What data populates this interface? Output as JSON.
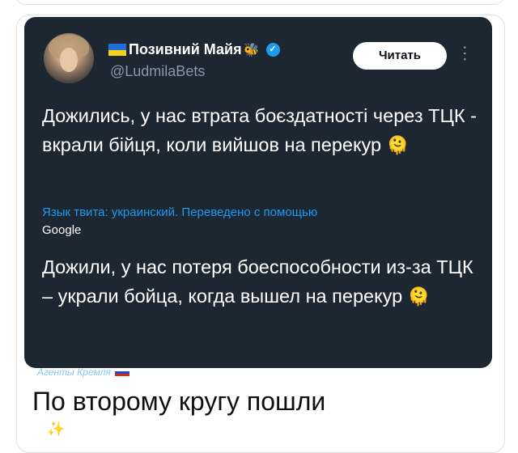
{
  "author": {
    "display_name": "Позивний Майя",
    "handle": "@LudmilaBets",
    "bee_emoji": "🐝",
    "verified_icon": "verified-badge-icon"
  },
  "actions": {
    "read_label": "Читать",
    "more_icon": "more-vertical-icon"
  },
  "tweet": {
    "original_text": "Дожились, у нас втрата боєздатності через ТЦК - вкрали бійця, коли вийшов на перекур",
    "original_emoji": "🫠",
    "translation_note": "Язык твита: украинский. Переведено с помощью",
    "translation_service": "Google",
    "translated_text": "Дожили, у нас потеря боеспособности из-за ТЦК – украли бойца, когда вышел на перекур",
    "translated_emoji": "🫠"
  },
  "watermark": {
    "text": "Агенты Кремля"
  },
  "post": {
    "caption": "По второму кругу пошли",
    "trailing_emoji": "✨"
  },
  "colors": {
    "tweet_background": "#1c2732",
    "link_blue": "#1d9bf0",
    "handle_gray": "#8899a6"
  }
}
